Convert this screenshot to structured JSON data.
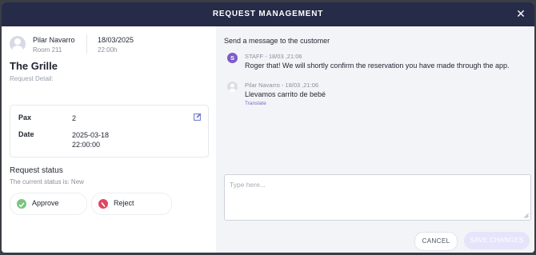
{
  "modal": {
    "title": "REQUEST MANAGEMENT",
    "close_icon": "close-icon"
  },
  "guest": {
    "name": "Pilar Navarro",
    "room": "Room 211",
    "date": "18/03/2025",
    "time": "22:00h"
  },
  "venue": "The Grille",
  "request_detail_label": "Request Detail:",
  "details": [
    {
      "key": "Pax",
      "value": "2"
    },
    {
      "key": "Date",
      "value": "2025-03-18\n22:00:00"
    }
  ],
  "status": {
    "title": "Request status",
    "current": "The current status is: New",
    "approve_label": "Approve",
    "reject_label": "Reject",
    "approve_color": "#7bc47f",
    "reject_color": "#e0455f"
  },
  "messages": {
    "heading": "Send a message to the customer",
    "items": [
      {
        "avatar": "S",
        "avatar_color": "#7b5cc9",
        "meta": "STAFF - 18/03 ,21:06",
        "text": "Roger that! We will shortly confirm the reservation you have made through the app."
      },
      {
        "avatar": "user-icon",
        "avatar_color": "#dcdee5",
        "meta": "Pilar Navarro - 18/03 ,21:06",
        "text": "Llevamos carrito de bebé",
        "translate_label": "Translate"
      }
    ],
    "reply_placeholder": "Type here..."
  },
  "actions": {
    "cancel_label": "CANCEL",
    "save_label": "SAVE CHANGES"
  },
  "colors": {
    "header_bg": "#262b48",
    "right_pane_bg": "#f3f4f8",
    "accent": "#6a72c9",
    "save_disabled_bg": "#e6e4fb"
  }
}
